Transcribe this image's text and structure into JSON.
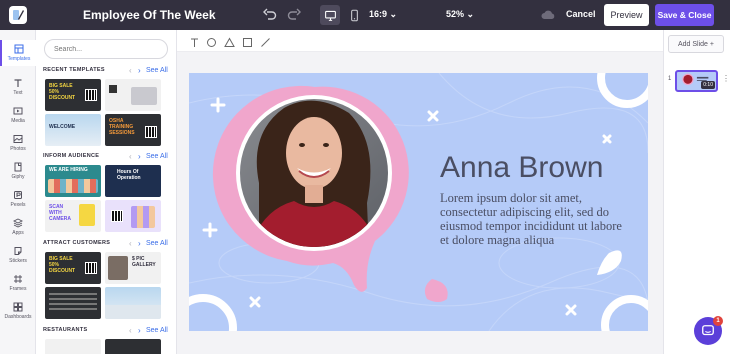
{
  "app": {
    "title": "Employee Of The Week",
    "aspect_ratio": "16:9",
    "zoom": "52%",
    "cancel_label": "Cancel",
    "preview_label": "Preview",
    "save_label": "Save & Close",
    "accent_color": "#6d4fe8"
  },
  "tools": [
    {
      "label": "Templates",
      "icon": "layout-icon"
    },
    {
      "label": "Text",
      "icon": "text-icon"
    },
    {
      "label": "Media",
      "icon": "media-icon"
    },
    {
      "label": "Photos",
      "icon": "photos-icon"
    },
    {
      "label": "Giphy",
      "icon": "giphy-icon"
    },
    {
      "label": "Pexels",
      "icon": "pexels-icon"
    },
    {
      "label": "Apps",
      "icon": "apps-icon"
    },
    {
      "label": "Stickers",
      "icon": "stickers-icon"
    },
    {
      "label": "Frames",
      "icon": "frames-icon"
    },
    {
      "label": "Dashboards",
      "icon": "dashboards-icon"
    }
  ],
  "panel": {
    "search_placeholder": "Search...",
    "see_all": "See All",
    "sections": [
      {
        "title": "RECENT TEMPLATES",
        "thumbs": [
          {
            "text": "BIG SALE 50% DISCOUNT"
          },
          {
            "text": ""
          },
          {
            "text": "WELCOME"
          },
          {
            "text": "OSHA TRAINING SESSIONS"
          }
        ]
      },
      {
        "title": "INFORM AUDIENCE",
        "thumbs": [
          {
            "text": "WE ARE HIRING"
          },
          {
            "text": "Hours Of Operation"
          },
          {
            "text": "SCAN WITH CAMERA"
          },
          {
            "text": ""
          }
        ]
      },
      {
        "title": "ATTRACT CUSTOMERS",
        "thumbs": [
          {
            "text": "BIG SALE 50% DISCOUNT"
          },
          {
            "text": "$ PIC GALLERY"
          },
          {
            "text": ""
          },
          {
            "text": ""
          }
        ]
      },
      {
        "title": "RESTAURANTS",
        "thumbs": []
      }
    ]
  },
  "slide": {
    "name": "Anna Brown",
    "description": "Lorem ipsum dolor sit amet, consectetur adipiscing elit, sed do eiusmod tempor incididunt ut labore et dolore magna aliqua",
    "background_color": "#b5cbf8",
    "frame_color": "#f0a6cc"
  },
  "slides_panel": {
    "add_slide": "Add Slide",
    "slide_number": "1",
    "thumb_duration": "0:10"
  },
  "chat": {
    "badge_count": "1"
  }
}
